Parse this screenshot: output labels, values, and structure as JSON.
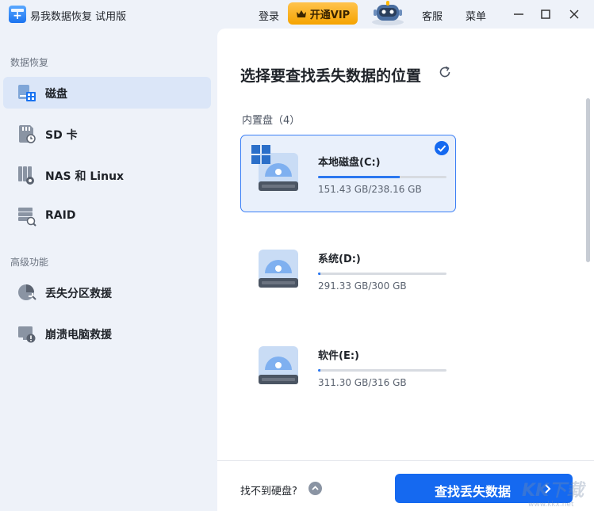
{
  "app": {
    "title": "易我数据恢复 试用版"
  },
  "titlebar": {
    "login_label": "登录",
    "vip_label": "开通VIP",
    "service_label": "客服",
    "menu_label": "菜单"
  },
  "sidebar": {
    "section_recovery": "数据恢复",
    "section_advanced": "高级功能",
    "items": [
      {
        "label": "磁盘",
        "icon": "disk-icon",
        "active": true
      },
      {
        "label": "SD 卡",
        "icon": "sd-card-icon"
      },
      {
        "label": "NAS 和 Linux",
        "icon": "nas-icon"
      },
      {
        "label": "RAID",
        "icon": "raid-icon"
      }
    ],
    "advanced_items": [
      {
        "label": "丢失分区救援",
        "icon": "partition-rescue-icon"
      },
      {
        "label": "崩溃电脑救援",
        "icon": "crashed-pc-icon"
      }
    ]
  },
  "main": {
    "title": "选择要查找丢失数据的位置",
    "section_label": "内置盘（4）",
    "disks": [
      {
        "name": "本地磁盘(C:)",
        "size": "151.43 GB/238.16 GB",
        "used_fraction": 0.636,
        "selected": true,
        "system": true
      },
      {
        "name": "系统(D:)",
        "size": "291.33 GB/300 GB",
        "used_fraction": 0.02,
        "selected": false
      },
      {
        "name": "软件(E:)",
        "size": "311.30 GB/316 GB",
        "used_fraction": 0.02,
        "selected": false
      }
    ],
    "not_found_label": "找不到硬盘?",
    "scan_label": "查找丢失数据"
  },
  "watermark": {
    "text": "KK下载",
    "sub": "www.kkx.net"
  },
  "colors": {
    "accent": "#1569f0",
    "selected_border": "#3b7ff5",
    "vip": "#f5a300",
    "sidebar_bg": "#eef2f9"
  }
}
